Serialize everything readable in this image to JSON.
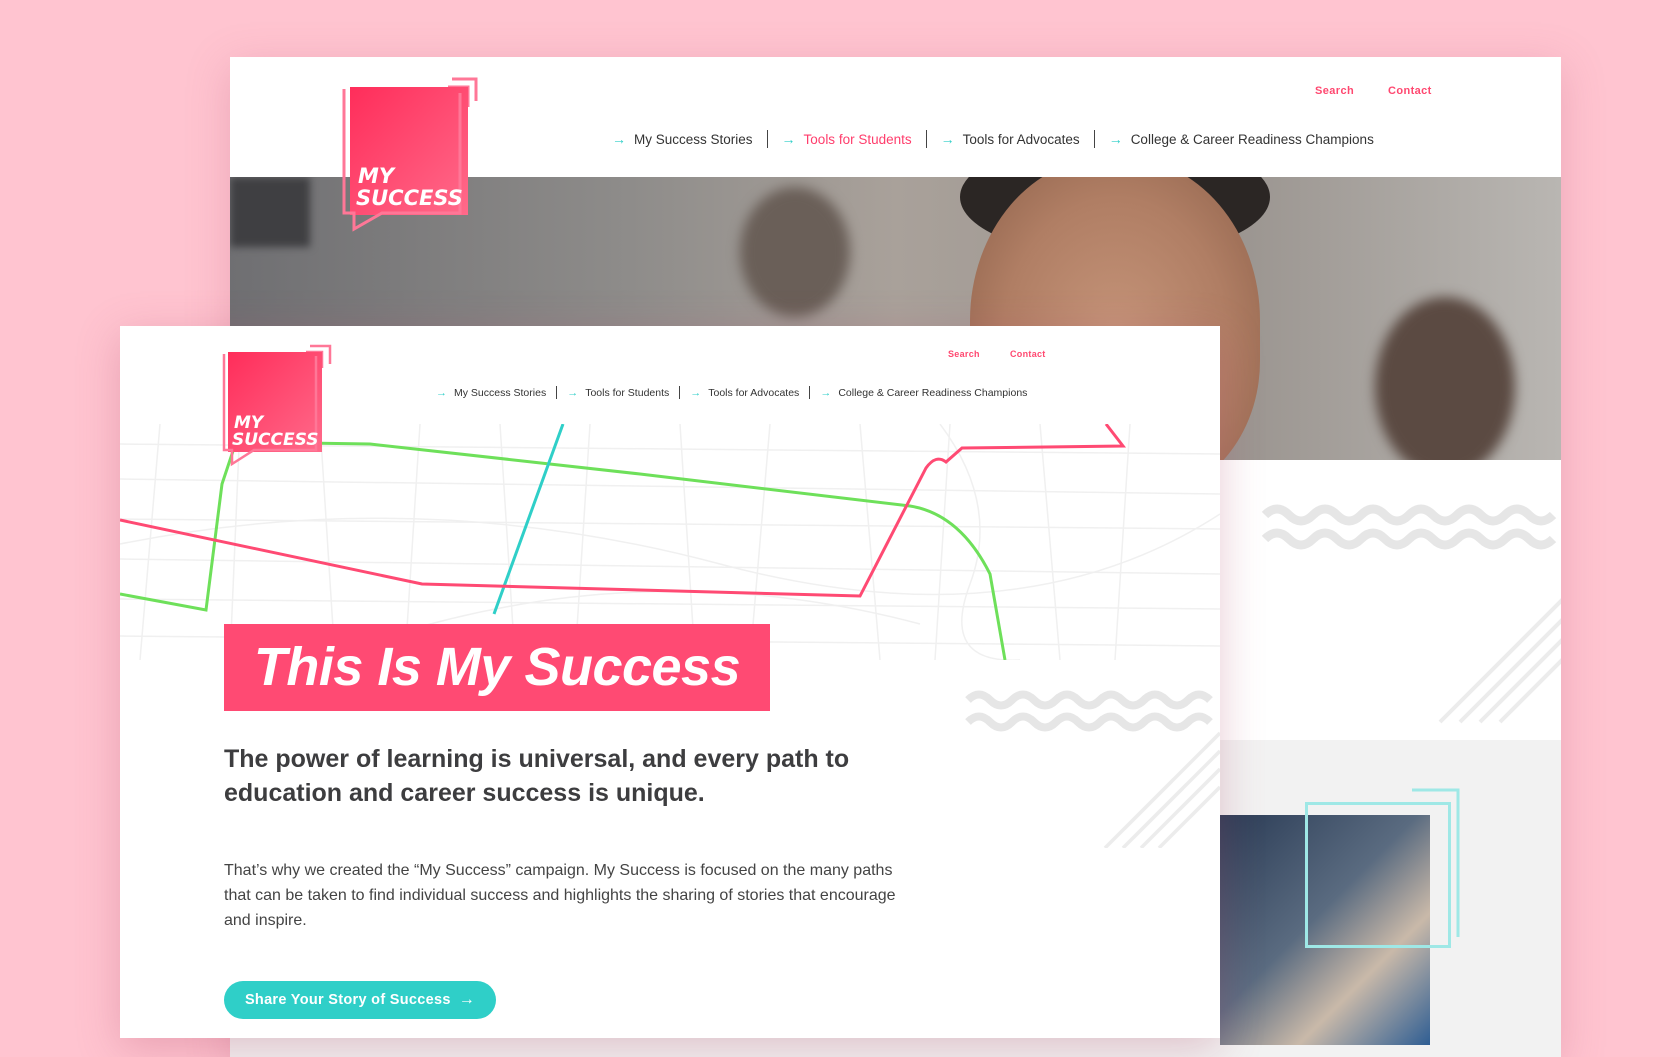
{
  "colors": {
    "background": "#ffc4d0",
    "brand_pink": "#ff4a73",
    "accent_teal": "#2fcfc8",
    "route_green": "#6ee05a",
    "text_dark": "#3d3d3f"
  },
  "logo": {
    "line1": "MY",
    "line2": "SUCCESS"
  },
  "back_window": {
    "utility": {
      "search": "Search",
      "contact": "Contact"
    },
    "nav": [
      {
        "label": "My Success Stories",
        "active": false
      },
      {
        "label": "Tools for Students",
        "active": true
      },
      {
        "label": "Tools for Advocates",
        "active": false
      },
      {
        "label": "College & Career Readiness Champions",
        "active": false
      }
    ]
  },
  "front_window": {
    "utility": {
      "search": "Search",
      "contact": "Contact"
    },
    "nav": [
      {
        "label": "My Success Stories"
      },
      {
        "label": "Tools for Students"
      },
      {
        "label": "Tools for Advocates"
      },
      {
        "label": "College & Career Readiness Champions"
      }
    ],
    "hero_title": "This Is My Success",
    "lead": "The power of learning is universal, and every path to education and career success is unique.",
    "body": "That’s why we created the “My Success” campaign. My Success is focused on the many paths that can be taken to find individual success and highlights the sharing of stories that encourage and inspire.",
    "cta_label": "Share Your Story of Success",
    "icons": {
      "nav_arrow": "arrow-right-icon",
      "cta_arrow": "arrow-right-icon"
    }
  }
}
